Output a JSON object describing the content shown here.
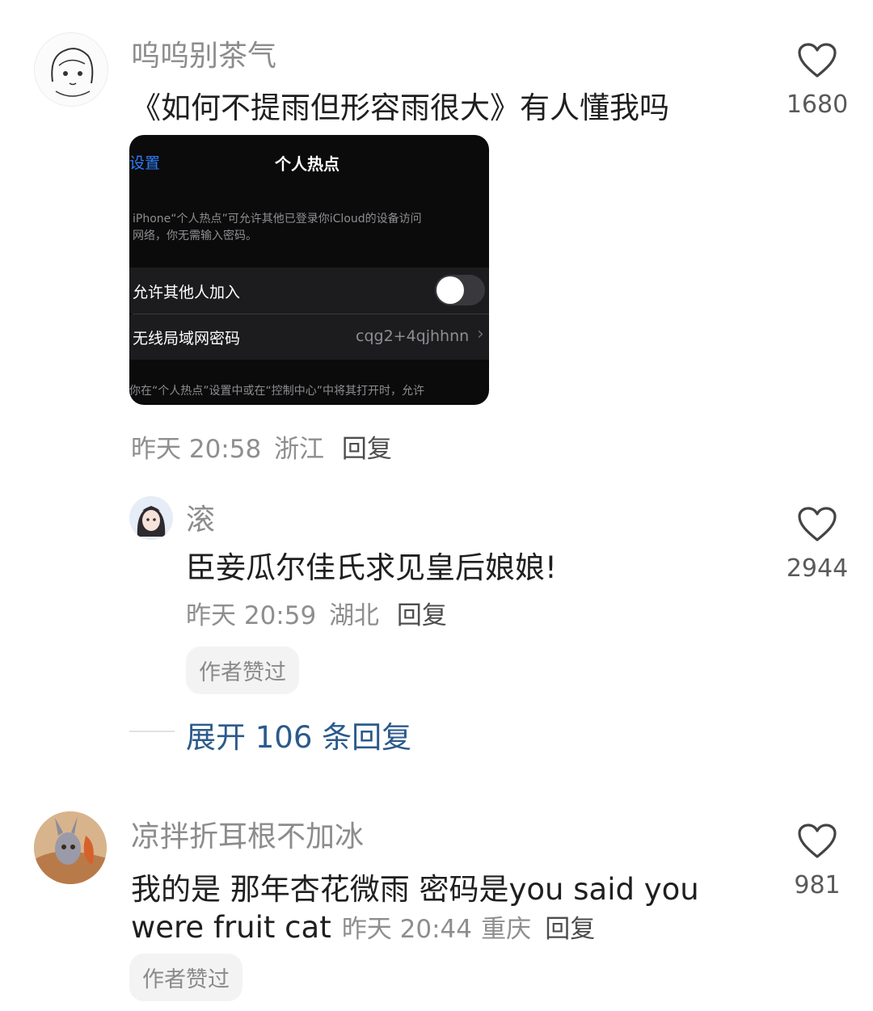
{
  "comments": [
    {
      "username": "呜呜别茶气",
      "text": "《如何不提雨但形容雨很大》有人懂我吗",
      "time": "昨天 20:58",
      "location": "浙江",
      "reply_label": "回复",
      "likes": "1680",
      "screenshot": {
        "back_label": "设置",
        "title": "个人热点",
        "description_line1": "iPhone“个人热点”可允许其他已登录你iCloud的设备访问",
        "description_line2": "网络，你无需输入密码。",
        "allow_others_label": "允许其他人加入",
        "allow_others_on": false,
        "wifi_password_label": "无线局域网密码",
        "wifi_password_value": "cqg2+4qjhhnn",
        "footer_text": "你在“个人热点”设置中或在“控制中心”中将其打开时，允许"
      }
    },
    {
      "username": "滚",
      "text": "臣妾瓜尔佳氏求见皇后娘娘!",
      "time": "昨天 20:59",
      "location": "湖北",
      "reply_label": "回复",
      "likes": "2944",
      "badge": "作者赞过"
    },
    {
      "username": "凉拌折耳根不加冰",
      "text_line1": "我的是 那年杏花微雨 密码是you said you",
      "text_line2": "were fruit cat",
      "time": "昨天 20:44",
      "location": "重庆",
      "reply_label": "回复",
      "likes": "981",
      "badge": "作者赞过"
    }
  ],
  "expand_replies": "展开 106 条回复",
  "colors": {
    "accent": "#2b5a8c",
    "meta_gray": "#8e8e8e",
    "ios_link": "#2f7cf6"
  }
}
